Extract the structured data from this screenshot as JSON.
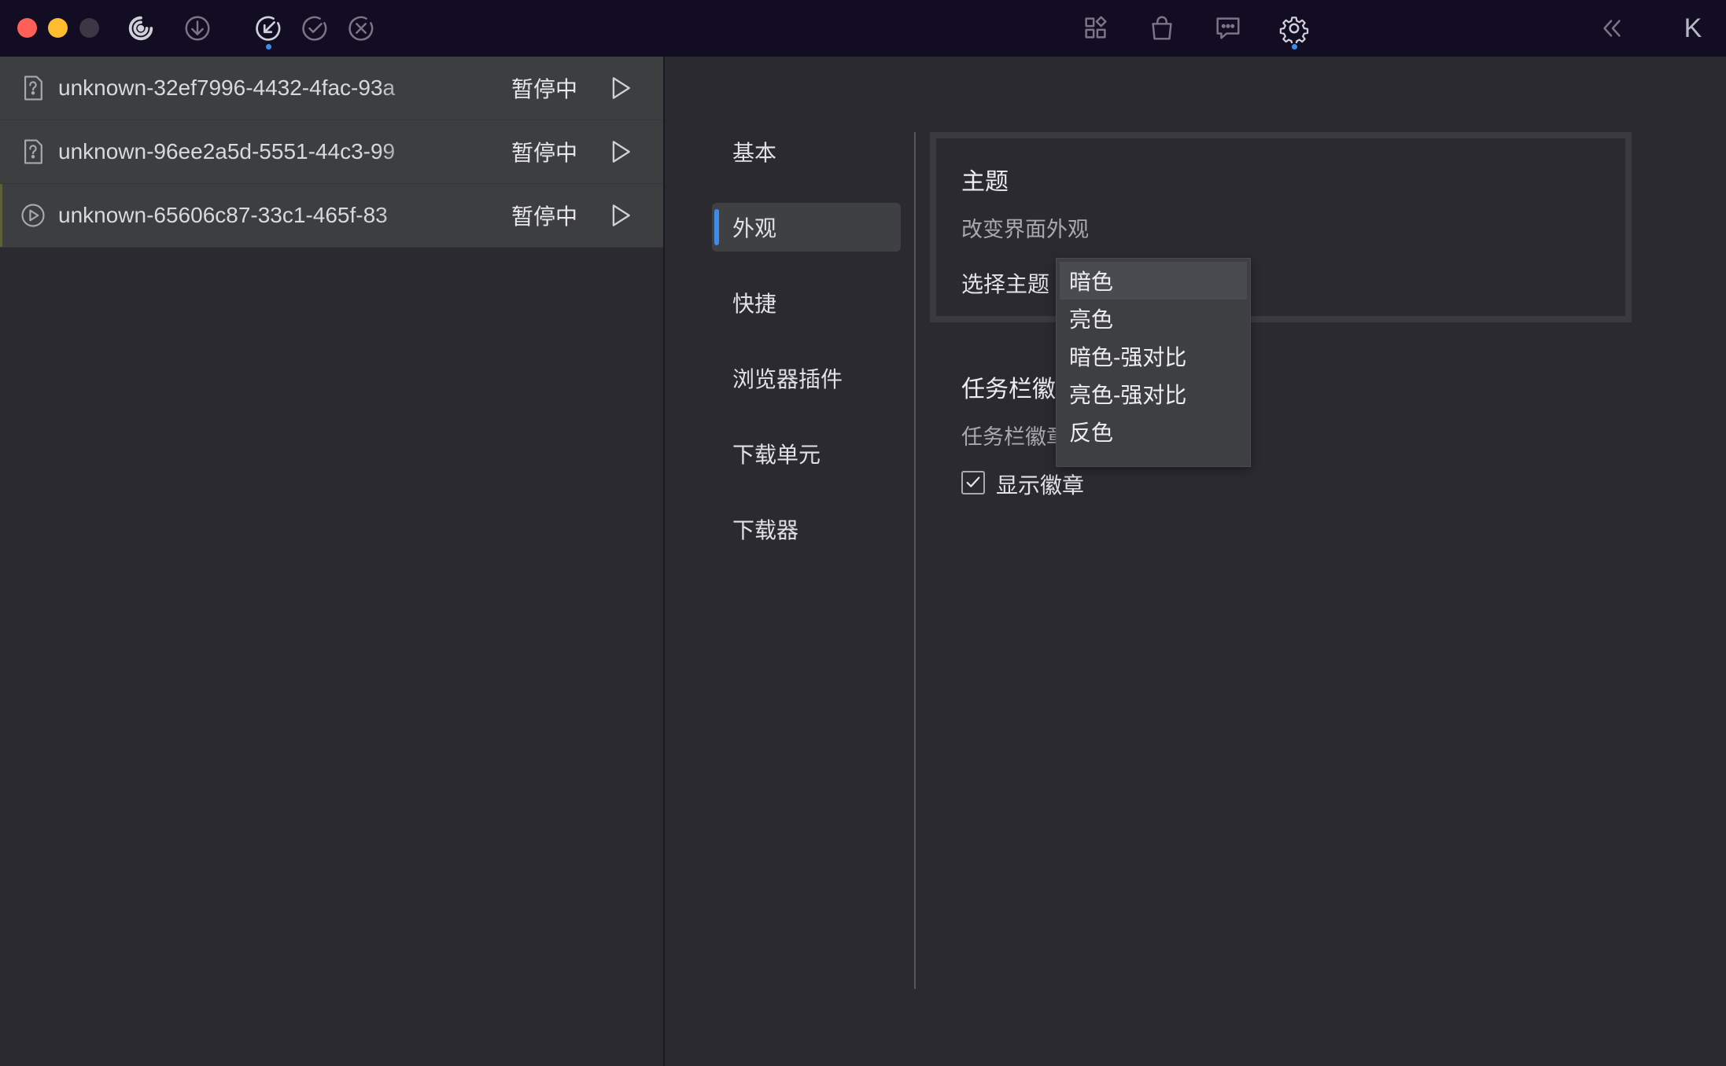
{
  "toolbar": {
    "left_icons": [
      "app-logo-icon",
      "download-icon",
      "downloading-icon",
      "completed-icon",
      "failed-icon"
    ],
    "center_icons": [
      "apps-icon",
      "bag-icon",
      "chat-icon",
      "settings-icon"
    ],
    "right_icons": [
      "collapse-icon"
    ],
    "right_letter": "K"
  },
  "tasks": [
    {
      "name": "unknown-32ef7996-4432-4fac-93a",
      "status": "暂停中",
      "icon": "unknown-file-icon"
    },
    {
      "name": "unknown-96ee2a5d-5551-44c3-99",
      "status": "暂停中",
      "icon": "unknown-file-icon"
    },
    {
      "name": "unknown-65606c87-33c1-465f-83",
      "status": "暂停中",
      "icon": "play-circle-icon"
    }
  ],
  "settings": {
    "nav": [
      "基本",
      "外观",
      "快捷",
      "浏览器插件",
      "下载单元",
      "下载器"
    ],
    "theme": {
      "title": "主题",
      "desc": "改变界面外观",
      "select_label": "选择主题",
      "options": [
        "暗色",
        "亮色",
        "暗色-强对比",
        "亮色-强对比",
        "反色"
      ],
      "selected": "暗色"
    },
    "badge": {
      "title": "任务栏徽",
      "desc": "任务栏徽章",
      "checkbox_label": "显示徽章",
      "checked": true
    }
  },
  "colors": {
    "accent": "#3f8ce8",
    "titlebar": "#130d24",
    "background": "#2b2a31",
    "task_row": "#3c3e40"
  }
}
